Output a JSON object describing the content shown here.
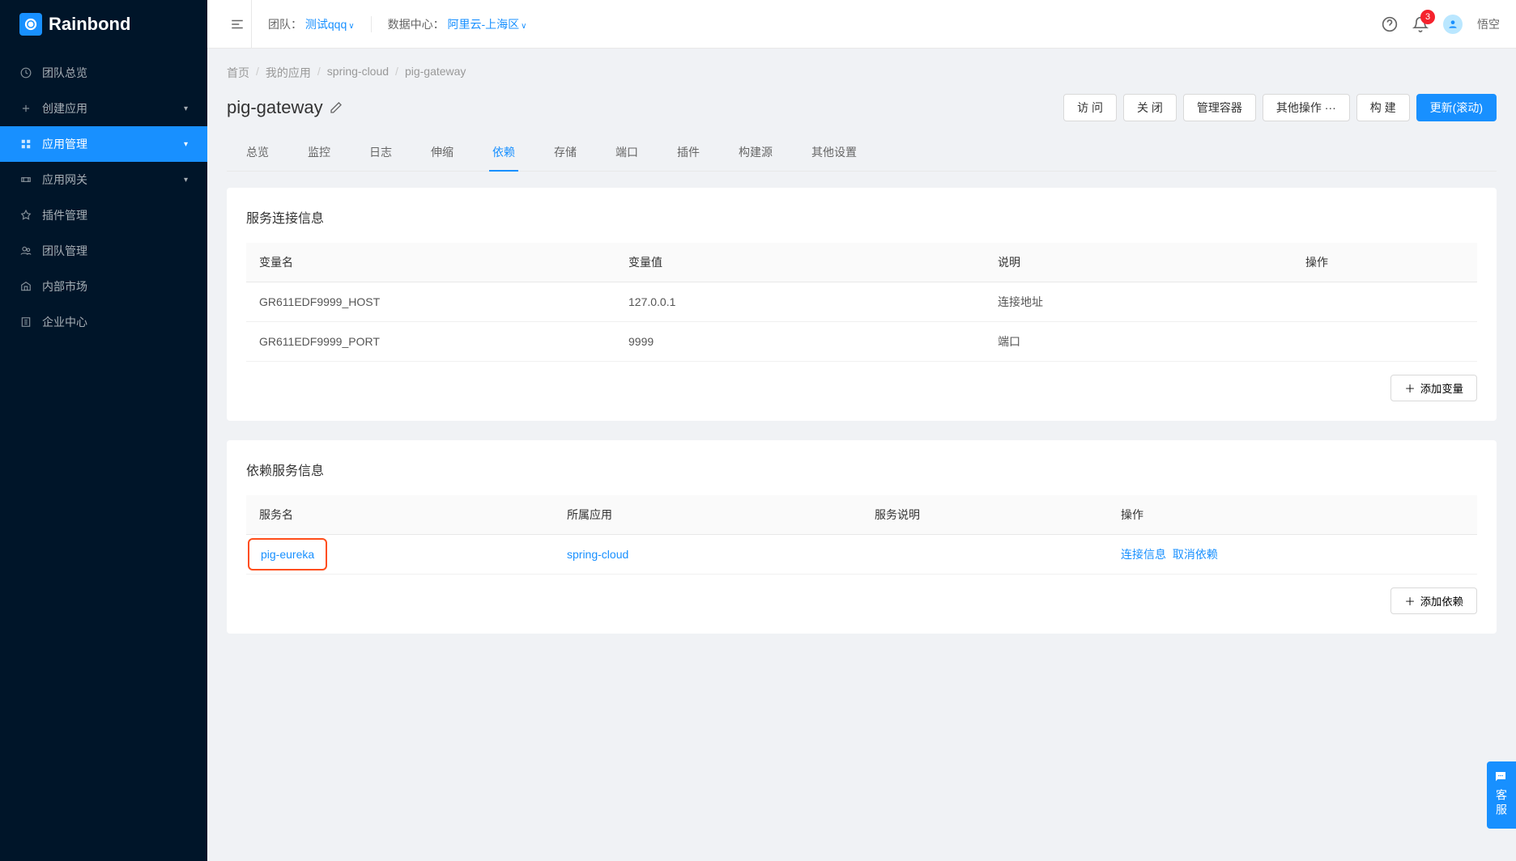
{
  "brand": "Rainbond",
  "sidebar": {
    "items": [
      {
        "label": "团队总览",
        "icon": "dashboard"
      },
      {
        "label": "创建应用",
        "icon": "plus",
        "expandable": true
      },
      {
        "label": "应用管理",
        "icon": "apps",
        "expandable": true,
        "active": true
      },
      {
        "label": "应用网关",
        "icon": "gateway",
        "expandable": true
      },
      {
        "label": "插件管理",
        "icon": "plugin"
      },
      {
        "label": "团队管理",
        "icon": "team"
      },
      {
        "label": "内部市场",
        "icon": "market"
      },
      {
        "label": "企业中心",
        "icon": "enterprise"
      }
    ]
  },
  "topbar": {
    "team_label": "团队：",
    "team_value": "测试qqq",
    "dc_label": "数据中心：",
    "dc_value": "阿里云-上海区",
    "notif_count": "3",
    "username": "悟空"
  },
  "breadcrumb": [
    "首页",
    "我的应用",
    "spring-cloud",
    "pig-gateway"
  ],
  "page_title": "pig-gateway",
  "actions": {
    "visit": "访 问",
    "close": "关 闭",
    "manage": "管理容器",
    "other": "其他操作  ···",
    "build": "构 建",
    "update": "更新(滚动)"
  },
  "tabs": [
    "总览",
    "监控",
    "日志",
    "伸缩",
    "依赖",
    "存储",
    "端口",
    "插件",
    "构建源",
    "其他设置"
  ],
  "active_tab": 4,
  "conn_section": {
    "title": "服务连接信息",
    "headers": [
      "变量名",
      "变量值",
      "说明",
      "操作"
    ],
    "rows": [
      {
        "name": "GR611EDF9999_HOST",
        "value": "127.0.0.1",
        "desc": "连接地址"
      },
      {
        "name": "GR611EDF9999_PORT",
        "value": "9999",
        "desc": "端口"
      }
    ],
    "add_btn": "添加变量"
  },
  "dep_section": {
    "title": "依赖服务信息",
    "headers": [
      "服务名",
      "所属应用",
      "服务说明",
      "操作"
    ],
    "rows": [
      {
        "service": "pig-eureka",
        "app": "spring-cloud",
        "desc": "",
        "op1": "连接信息",
        "op2": "取消依赖"
      }
    ],
    "add_btn": "添加依赖"
  },
  "support_label": "客服"
}
